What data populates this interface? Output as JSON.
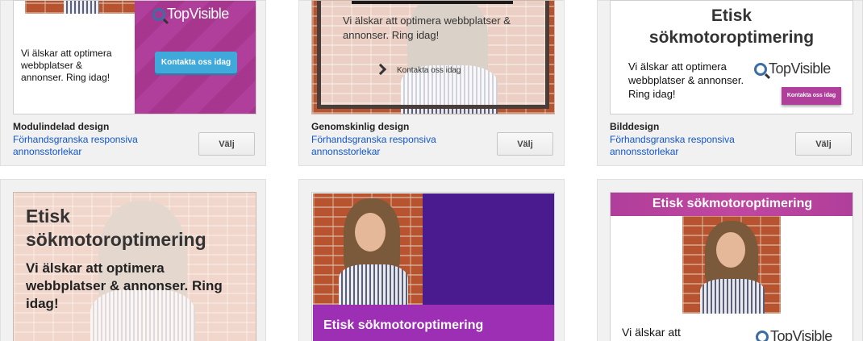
{
  "cards": [
    {
      "title": "Modulindelad design",
      "link": "Förhandsgranska responsiva annonsstorlekar",
      "button": "Välj",
      "ad": {
        "body": "Vi älskar att optimera webbplatser & annonser. Ring idag!",
        "cta": "Kontakta oss idag",
        "logo": "TopVisible"
      }
    },
    {
      "title": "Genomskinlig design",
      "link": "Förhandsgranska responsiva annonsstorlekar",
      "button": "Välj",
      "ad": {
        "body": "Vi älskar att optimera webbplatser & annonser. Ring idag!",
        "cta": "Kontakta oss idag"
      }
    },
    {
      "title": "Bilddesign",
      "link": "Förhandsgranska responsiva annonsstorlekar",
      "button": "Välj",
      "ad": {
        "headline": "Etisk sökmotoroptimering",
        "body": "Vi älskar att optimera webbplatser & annonser. Ring idag!",
        "cta": "Kontakta oss idag",
        "logo": "TopVisible"
      }
    },
    {
      "ad": {
        "headline": "Etisk sökmotoroptimering",
        "body": "Vi älskar att optimera webbplatser & annonser. Ring idag!"
      }
    },
    {
      "ad": {
        "headline": "Etisk sökmotoroptimering"
      }
    },
    {
      "ad": {
        "headline": "Etisk sökmotoroptimering",
        "body": "Vi älskar att",
        "logo": "TopVisible"
      }
    }
  ],
  "colors": {
    "link": "#1155cc",
    "magenta": "#b03e9b",
    "purple": "#4a1a8f",
    "violet": "#9c2fb4",
    "cta_blue": "#3fa9dc"
  }
}
